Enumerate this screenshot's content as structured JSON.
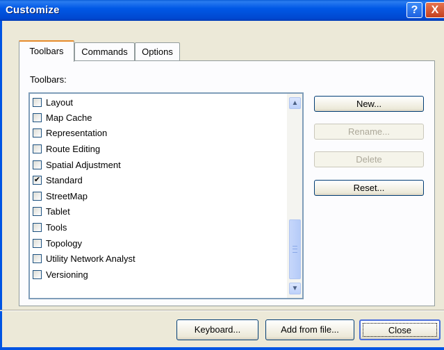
{
  "window": {
    "title": "Customize",
    "help_button": "?",
    "close_button": "X"
  },
  "tabs": [
    {
      "label": "Toolbars",
      "active": true
    },
    {
      "label": "Commands",
      "active": false
    },
    {
      "label": "Options",
      "active": false
    }
  ],
  "toolbars_label": "Toolbars:",
  "toolbars": [
    {
      "label": "Layout",
      "checked": false
    },
    {
      "label": "Map Cache",
      "checked": false
    },
    {
      "label": "Representation",
      "checked": false
    },
    {
      "label": "Route Editing",
      "checked": false
    },
    {
      "label": "Spatial Adjustment",
      "checked": false
    },
    {
      "label": "Standard",
      "checked": true
    },
    {
      "label": "StreetMap",
      "checked": false
    },
    {
      "label": "Tablet",
      "checked": false
    },
    {
      "label": "Tools",
      "checked": false
    },
    {
      "label": "Topology",
      "checked": false
    },
    {
      "label": "Utility Network Analyst",
      "checked": false
    },
    {
      "label": "Versioning",
      "checked": false
    }
  ],
  "side_buttons": {
    "new": "New...",
    "rename": "Rename...",
    "delete": "Delete",
    "reset": "Reset..."
  },
  "bottom_buttons": {
    "keyboard": "Keyboard...",
    "add_from_file": "Add from file...",
    "close": "Close"
  },
  "colors": {
    "titlebar": "#0058e6",
    "dialog_bg": "#ece9d8",
    "tab_accent": "#e68b2c"
  }
}
